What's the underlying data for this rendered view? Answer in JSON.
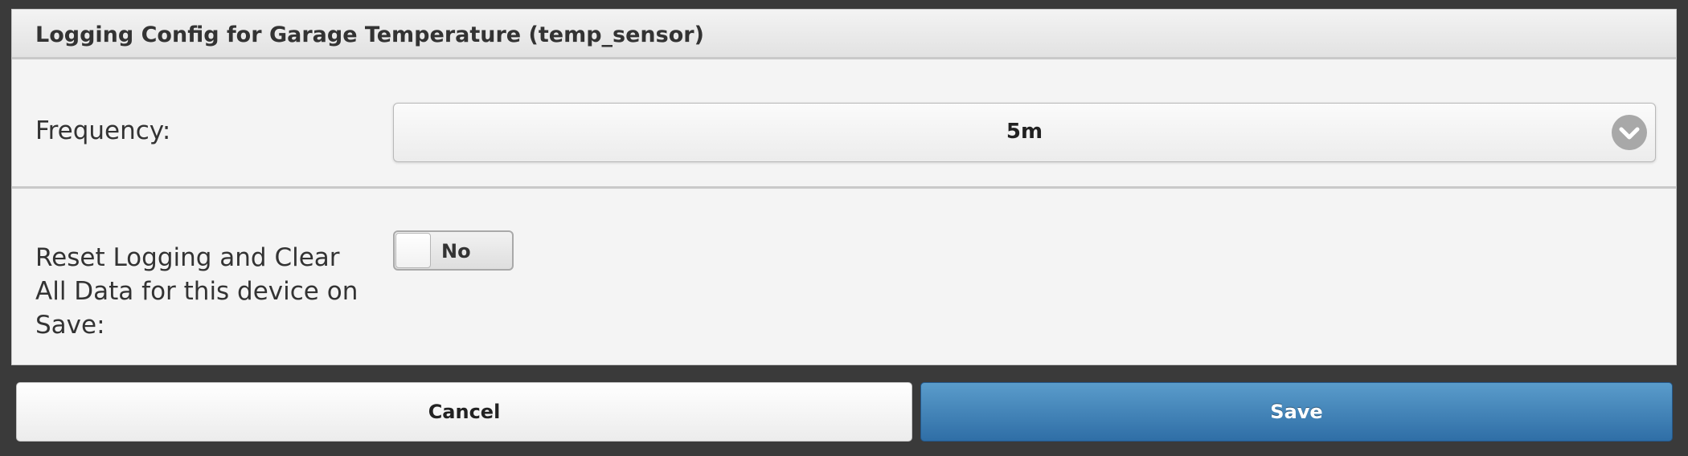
{
  "dialog": {
    "title": "Logging Config for Garage Temperature (temp_sensor)"
  },
  "frequency": {
    "label": "Frequency:",
    "selected_value": "5m",
    "caret_icon": "chevron-down-icon"
  },
  "reset": {
    "label": "Reset Logging and Clear All Data for this device on Save:",
    "toggle_state": "No"
  },
  "actions": {
    "cancel_label": "Cancel",
    "save_label": "Save"
  },
  "colors": {
    "save_button": "#3f7fb5",
    "background": "#3a3a3a"
  }
}
